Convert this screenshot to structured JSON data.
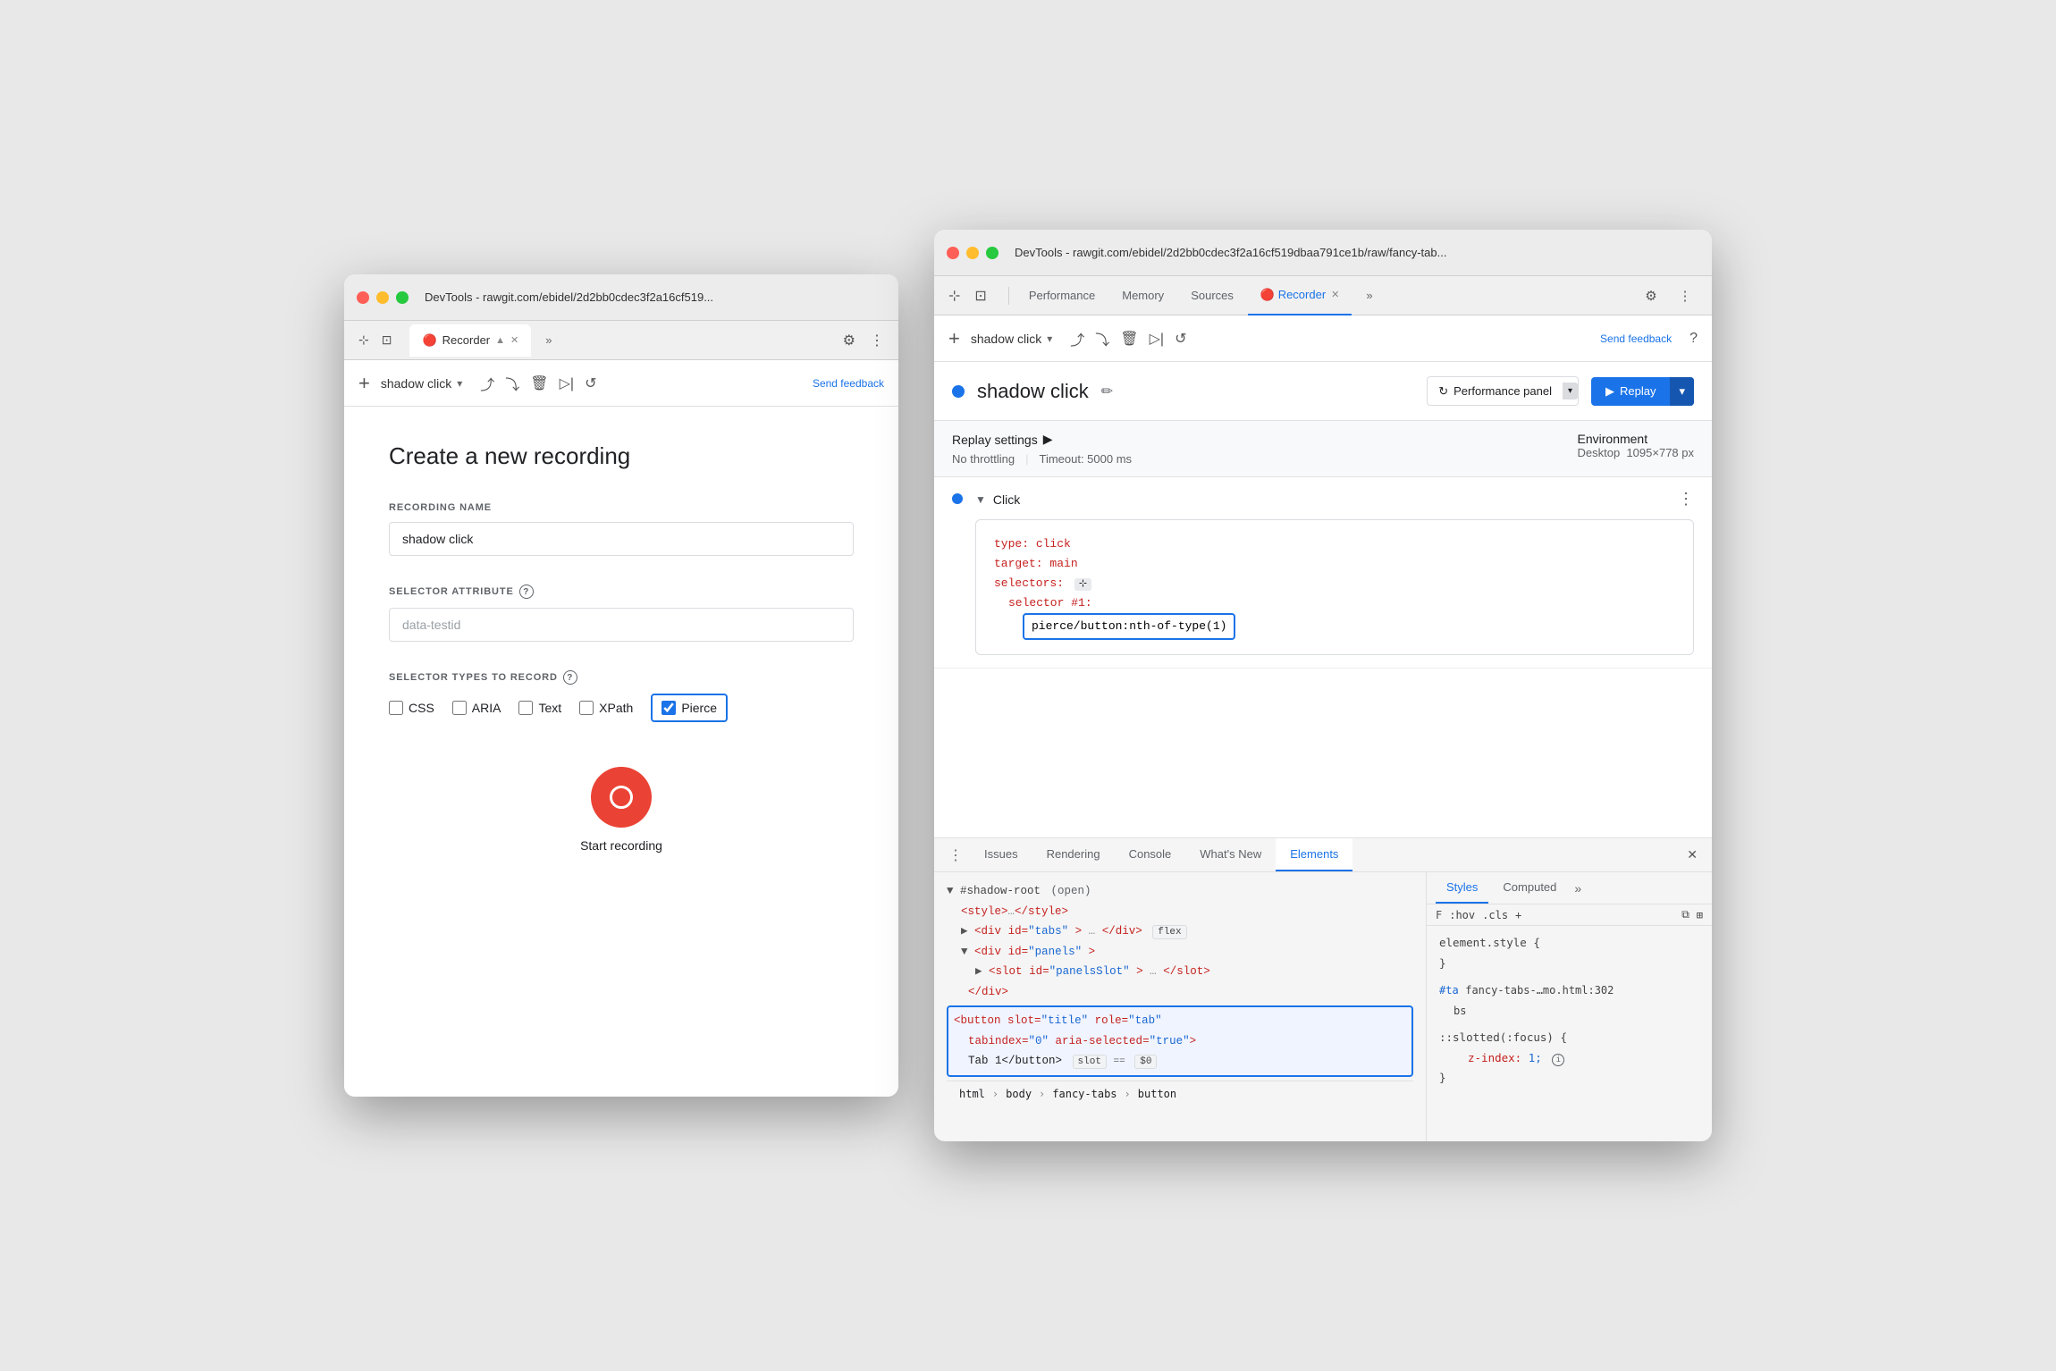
{
  "left_window": {
    "title": "DevTools - rawgit.com/ebidel/2d2bb0cdec3f2a16cf519...",
    "tab_label": "Recorder",
    "tab_icon": "🔴",
    "recording_name": "shadow click",
    "send_feedback": "Send feedback",
    "panel": {
      "title": "Create a new recording",
      "recording_name_label": "RECORDING NAME",
      "recording_name_value": "shadow click",
      "selector_attr_label": "SELECTOR ATTRIBUTE",
      "selector_attr_placeholder": "data-testid",
      "selector_types_label": "SELECTOR TYPES TO RECORD",
      "checkboxes": [
        {
          "id": "css",
          "label": "CSS",
          "checked": false
        },
        {
          "id": "aria",
          "label": "ARIA",
          "checked": false
        },
        {
          "id": "text",
          "label": "Text",
          "checked": false
        },
        {
          "id": "xpath",
          "label": "XPath",
          "checked": false
        },
        {
          "id": "pierce",
          "label": "Pierce",
          "checked": true
        }
      ],
      "start_recording_label": "Start recording"
    }
  },
  "right_window": {
    "title": "DevTools - rawgit.com/ebidel/2d2bb0cdec3f2a16cf519dbaa791ce1b/raw/fancy-tab...",
    "nav_tabs": [
      "Performance",
      "Memory",
      "Sources",
      "Recorder",
      ""
    ],
    "active_tab": "Recorder",
    "toolbar_icons": [
      "upload",
      "download",
      "delete",
      "step",
      "replay"
    ],
    "send_feedback": "Send feedback",
    "help": "?",
    "recording_name": "shadow click",
    "perf_panel_btn": "Performance panel",
    "replay_btn": "Replay",
    "replay_settings": {
      "title": "Replay settings",
      "no_throttling": "No throttling",
      "timeout": "Timeout: 5000 ms"
    },
    "environment": {
      "label": "Environment",
      "value": "Desktop",
      "resolution": "1095×778 px"
    },
    "step": {
      "title": "Click",
      "type_key": "type:",
      "type_val": "click",
      "target_key": "target:",
      "target_val": "main",
      "selectors_key": "selectors:",
      "selector1_key": "selector #1:",
      "selector1_val": "pierce/button:nth-of-type(1)"
    },
    "bottom_tabs": [
      "Issues",
      "Rendering",
      "Console",
      "What's New",
      "Elements"
    ],
    "active_bottom_tab": "Elements",
    "dom": {
      "shadow_root": "▼ #shadow-root",
      "shadow_open": "(open)",
      "style_tag": "<style>…</style>",
      "div_tabs": "<div id=\"tabs\">…</div>",
      "flex_badge": "flex",
      "div_panels": "<div id=\"panels\">",
      "slot_panels": "<slot id=\"panelsSlot\">…</slot>",
      "div_close": "</div>",
      "button_html": "<button slot=\"title\" role=\"tab\"",
      "button_tabindex": "tabindex=\"0\" aria-selected=\"true\">",
      "button_text": "Tab 1</button>",
      "slot_badge": "slot",
      "dollar_badge": "== $0"
    },
    "breadcrumb": [
      "html",
      "body",
      "fancy-tabs",
      "button"
    ],
    "styles": {
      "tabs": [
        "Styles",
        "Computed"
      ],
      "toolbar_items": [
        "F",
        ":hov",
        ".cls",
        "+"
      ],
      "rule1_selector": "element.style {",
      "rule1_close": "}",
      "rule2_selector": "#ta",
      "rule2_source": "fancy-tabs-…mo.html:302",
      "rule2_extra": "bs",
      "rule3_selector": "::slotted(:focus) {",
      "rule3_prop": "z-index:",
      "rule3_val": "1;",
      "rule3_close": "}"
    }
  }
}
